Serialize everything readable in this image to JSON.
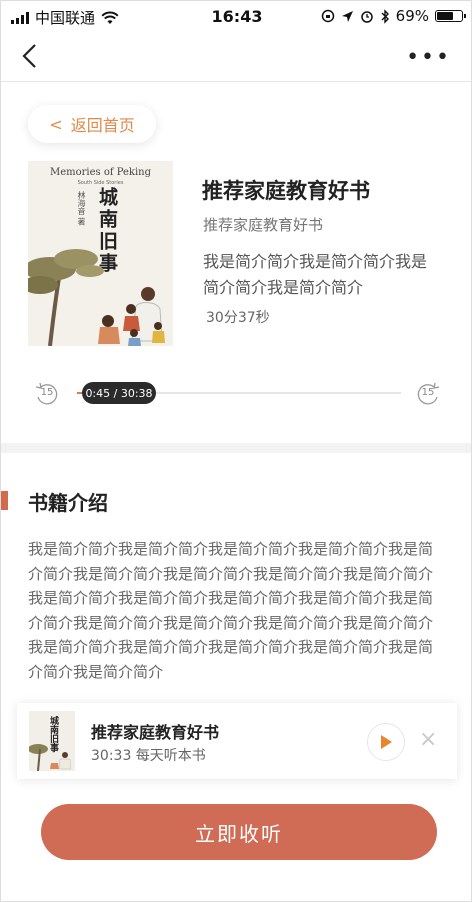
{
  "status_bar": {
    "carrier": "中国联通",
    "time": "16:43",
    "battery": "69%",
    "battery_level": 0.69
  },
  "nav": {
    "more_label": "•••"
  },
  "home_button": {
    "chevron": "<",
    "label": "返回首页"
  },
  "book": {
    "cover_en_title": "Memories of Peking",
    "cover_en_subtitle": "South Side Stories",
    "cover_cn_title": "城南旧事",
    "cover_author": "林海音 著",
    "title": "推荐家庭教育好书",
    "subtitle": "推荐家庭教育好书",
    "description": "我是简介简介我是简介简介我是简介简介我是简介简介",
    "duration": "30分37秒"
  },
  "player": {
    "skip_back_label": "15",
    "skip_forward_label": "15",
    "time_display": "0:45 / 30:38",
    "progress": 0.025
  },
  "intro": {
    "heading": "书籍介绍",
    "text": "我是简介简介我是简介简介我是简介简介我是简介简介我是简介简介我是简介简介我是简介简介我是简介简介我是简介简介我是简介简介我是简介简介我是简介简介我是简介简介我是简介简介我是简介简介我是简介简介我是简介简介我是简介简介我是简介简介我是简介简介我是简介简介我是简介简介我是简介简介我是简介简介"
  },
  "mini_player": {
    "cover_cn_title": "城南旧事",
    "title": "推荐家庭教育好书",
    "meta": "30:33  每天听本书",
    "close_label": "×"
  },
  "subscribe_button": {
    "label": "立即收听"
  },
  "colors": {
    "accent_orange": "#e08a4c",
    "button_red": "#d06b55",
    "section_bar": "#d36a4f"
  }
}
